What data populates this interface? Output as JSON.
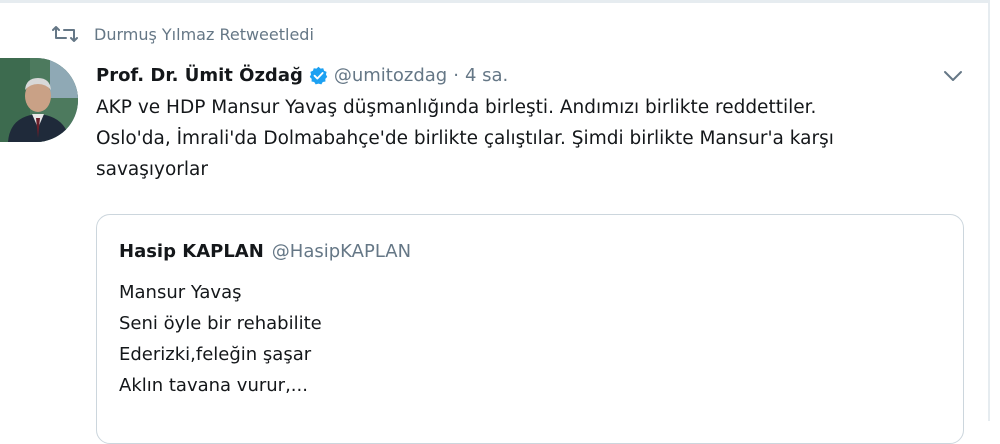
{
  "retweet": {
    "by_text": "Durmuş Yılmaz Retweetledi",
    "icon": "retweet-icon"
  },
  "tweet": {
    "author_name": "Prof. Dr. Ümit Özdağ",
    "handle": "@umitozdag",
    "separator": "·",
    "time": "4 sa.",
    "verified_icon": "verified-badge-icon",
    "body_lines": [
      "AKP ve HDP Mansur Yavaş düşmanlığında birleşti. Andımızı birlikte reddettiler.",
      "Oslo'da, İmrali'da Dolmabahçe'de birlikte çalıştılar. Şimdi birlikte Mansur'a karşı",
      "savaşıyorlar"
    ]
  },
  "quote": {
    "author_name": "Hasip KAPLAN",
    "handle": "@HasipKAPLAN",
    "lines": [
      "Mansur Yavaş",
      "Seni öyle bir rehabilite",
      "Ederizki,feleğin şaşar",
      "Aklın tavana vurur,..."
    ]
  },
  "colors": {
    "text": "#14171a",
    "secondary": "#657786",
    "verified": "#1da1f2",
    "border": "#ccd6dd"
  }
}
